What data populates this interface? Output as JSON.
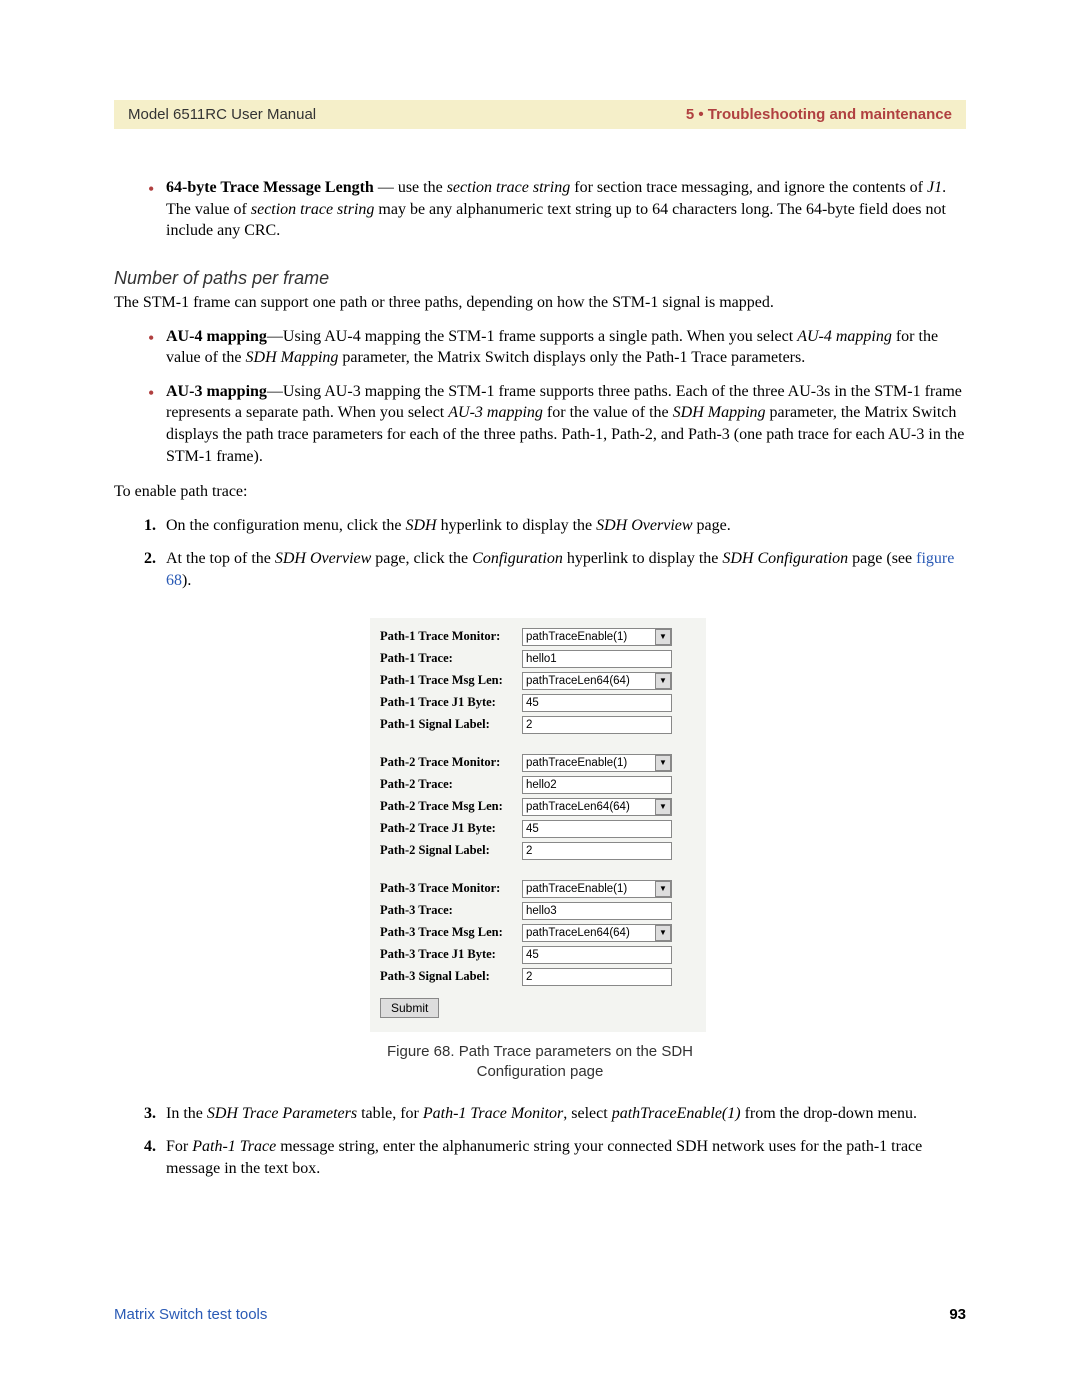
{
  "header": {
    "left": "Model 6511RC User Manual",
    "right": "5 • Troubleshooting and maintenance"
  },
  "intro_bullet": {
    "lead": "64-byte Trace Message Length",
    "dash": " — use the ",
    "em1": "section trace string",
    "mid1": " for section trace messaging, and ignore the contents of ",
    "em2": "J1",
    "mid2": ". The value of ",
    "em3": "section trace string",
    "tail": " may be any alphanumeric text string up to 64 characters long. The 64-byte field does not include any CRC."
  },
  "subhead": "Number of paths per frame",
  "para1": "The STM-1 frame can support one path or three paths, depending on how the STM-1 signal is mapped.",
  "mapping_bullets": {
    "au4": {
      "lead": "AU-4 mapping",
      "t1": "—Using AU-4 mapping the STM-1 frame supports a single path. When you select ",
      "em1": "AU-4 mapping",
      "t2": " for the value of the ",
      "em2": "SDH Mapping",
      "t3": " parameter, the Matrix Switch displays only the Path-1 Trace parameters."
    },
    "au3": {
      "lead": "AU-3 mapping",
      "t1": "—Using AU-3 mapping the STM-1 frame supports three paths. Each of the three AU-3s in the STM-1 frame represents a separate path. When you select ",
      "em1": "AU-3 mapping",
      "t2": " for the value of the ",
      "em2": "SDH Mapping",
      "t3": " parameter, the Matrix Switch displays the path trace parameters for each of the three paths. Path-1, Path-2, and Path-3 (one path trace for each AU-3 in the STM-1 frame)."
    }
  },
  "enable_para": "To enable path trace:",
  "steps": {
    "s1": {
      "t1": "On the configuration menu, click the ",
      "em1": "SDH",
      "t2": " hyperlink to display the ",
      "em2": "SDH Overview",
      "t3": " page."
    },
    "s2": {
      "t1": "At the top of the ",
      "em1": "SDH Overview",
      "t2": " page, click the ",
      "em2": "Configuration",
      "t3": " hyperlink to display the ",
      "em3": "SDH Configuration",
      "t4": " page (see ",
      "link": "figure 68",
      "t5": ")."
    },
    "s3": {
      "t1": "In the ",
      "em1": "SDH Trace Parameters",
      "t2": " table, for ",
      "em2": "Path-1 Trace Monitor",
      "t3": ", select ",
      "em3": "pathTraceEnable(1)",
      "t4": " from the drop-down menu."
    },
    "s4": {
      "t1": "For ",
      "em1": "Path-1 Trace",
      "t2": " message string, enter the alphanumeric string your connected SDH network uses for the path-1 trace message in the text box."
    }
  },
  "figure": {
    "paths": [
      {
        "monitor_label": "Path-1 Trace Monitor:",
        "monitor_value": "pathTraceEnable(1)",
        "trace_label": "Path-1 Trace:",
        "trace_value": "hello1",
        "msglen_label": "Path-1 Trace Msg Len:",
        "msglen_value": "pathTraceLen64(64)",
        "j1_label": "Path-1 Trace J1 Byte:",
        "j1_value": "45",
        "sig_label": "Path-1 Signal Label:",
        "sig_value": "2"
      },
      {
        "monitor_label": "Path-2 Trace Monitor:",
        "monitor_value": "pathTraceEnable(1)",
        "trace_label": "Path-2 Trace:",
        "trace_value": "hello2",
        "msglen_label": "Path-2 Trace Msg Len:",
        "msglen_value": "pathTraceLen64(64)",
        "j1_label": "Path-2 Trace J1 Byte:",
        "j1_value": "45",
        "sig_label": "Path-2 Signal Label:",
        "sig_value": "2"
      },
      {
        "monitor_label": "Path-3 Trace Monitor:",
        "monitor_value": "pathTraceEnable(1)",
        "trace_label": "Path-3 Trace:",
        "trace_value": "hello3",
        "msglen_label": "Path-3 Trace Msg Len:",
        "msglen_value": "pathTraceLen64(64)",
        "j1_label": "Path-3 Trace J1 Byte:",
        "j1_value": "45",
        "sig_label": "Path-3 Signal Label:",
        "sig_value": "2"
      }
    ],
    "submit": "Submit",
    "caption": "Figure 68. Path Trace parameters on the SDH Configuration page"
  },
  "footer": {
    "left": "Matrix Switch test tools",
    "right": "93"
  }
}
